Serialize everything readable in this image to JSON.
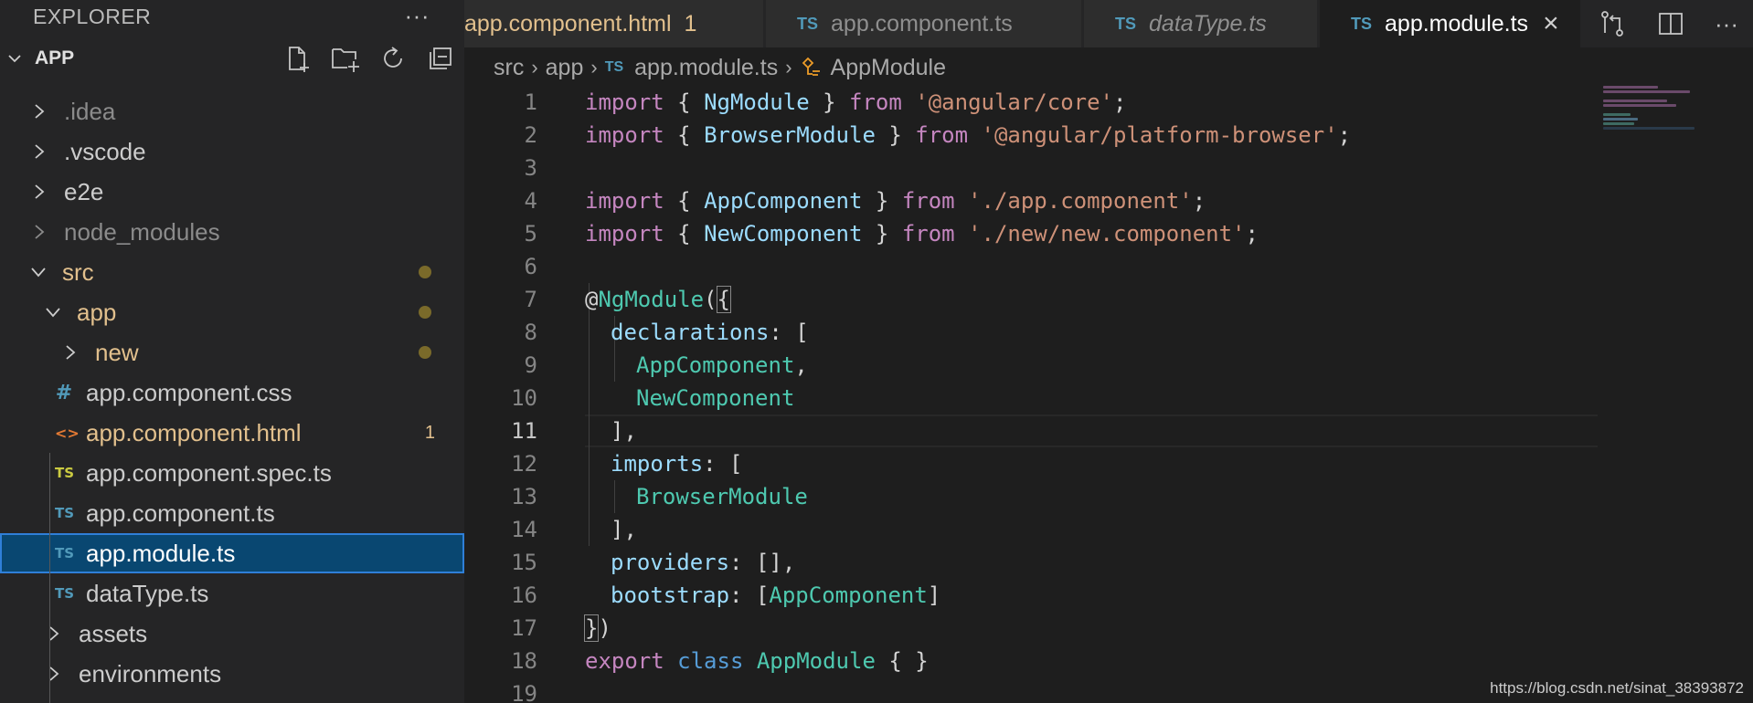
{
  "explorer": {
    "title": "EXPLORER",
    "more": "···",
    "section": "APP",
    "tree": [
      {
        "label": ".idea",
        "badge": ""
      },
      {
        "label": ".vscode",
        "badge": ""
      },
      {
        "label": "e2e",
        "badge": ""
      },
      {
        "label": "node_modules",
        "badge": ""
      },
      {
        "label": "src",
        "badge": ""
      },
      {
        "label": "app",
        "badge": ""
      },
      {
        "label": "new",
        "badge": ""
      },
      {
        "label": "app.component.css",
        "badge": "",
        "icon": "#"
      },
      {
        "label": "app.component.html",
        "badge": "1",
        "icon": "<>"
      },
      {
        "label": "app.component.spec.ts",
        "badge": "",
        "icon": "TS"
      },
      {
        "label": "app.component.ts",
        "badge": "",
        "icon": "TS"
      },
      {
        "label": "app.module.ts",
        "badge": "",
        "icon": "TS"
      },
      {
        "label": "dataType.ts",
        "badge": "",
        "icon": "TS"
      },
      {
        "label": "assets",
        "badge": ""
      },
      {
        "label": "environments",
        "badge": ""
      }
    ]
  },
  "tabs": [
    {
      "label": "app.component.html",
      "badge": "1"
    },
    {
      "label": "app.component.ts",
      "icon": "TS"
    },
    {
      "label": "dataType.ts",
      "icon": "TS"
    },
    {
      "label": "app.module.ts",
      "icon": "TS",
      "close": "×"
    }
  ],
  "breadcrumb": {
    "parts": [
      "src",
      "app",
      "app.module.ts",
      "AppModule"
    ],
    "icon": "TS"
  },
  "editor": {
    "line_numbers": [
      "1",
      "2",
      "3",
      "4",
      "5",
      "6",
      "7",
      "8",
      "9",
      "10",
      "11",
      "12",
      "13",
      "14",
      "15",
      "16",
      "17",
      "18",
      "19"
    ],
    "current_line": "11",
    "lines": {
      "l1": {
        "a": "import",
        "b": " { ",
        "c": "NgModule",
        "d": " } ",
        "e": "from",
        "f": " ",
        "g": "'@angular/core'",
        "h": ";"
      },
      "l2": {
        "a": "import",
        "b": " { ",
        "c": "BrowserModule",
        "d": " } ",
        "e": "from",
        "f": " ",
        "g": "'@angular/platform-browser'",
        "h": ";"
      },
      "l4": {
        "a": "import",
        "b": " { ",
        "c": "AppComponent",
        "d": " } ",
        "e": "from",
        "f": " ",
        "g": "'./app.component'",
        "h": ";"
      },
      "l5": {
        "a": "import",
        "b": " { ",
        "c": "NewComponent",
        "d": " } ",
        "e": "from",
        "f": " ",
        "g": "'./new/new.component'",
        "h": ";"
      },
      "l7": {
        "a": "@",
        "b": "NgModule",
        "c": "(",
        "d": "{"
      },
      "l8": {
        "a": "declarations",
        "b": ": ["
      },
      "l9": {
        "a": "AppComponent",
        "b": ","
      },
      "l10": {
        "a": "NewComponent"
      },
      "l11": {
        "a": "],"
      },
      "l12": {
        "a": "imports",
        "b": ": ["
      },
      "l13": {
        "a": "BrowserModule"
      },
      "l14": {
        "a": "],"
      },
      "l15": {
        "a": "providers",
        "b": ": [],"
      },
      "l16": {
        "a": "bootstrap",
        "b": ": [",
        "c": "AppComponent",
        "d": "]"
      },
      "l17": {
        "a": "}",
        "b": ")"
      },
      "l18": {
        "a": "export",
        "b": " ",
        "c": "class",
        "d": " ",
        "e": "AppModule",
        "f": " { }"
      }
    }
  },
  "watermark": "https://blog.csdn.net/sinat_38393872",
  "colors": {
    "accent": "#007fd4",
    "modified": "#e2c08d",
    "keyword": "#c586c0",
    "string": "#ce9178",
    "type": "#4ec9b0",
    "property": "#9cdcfe"
  }
}
